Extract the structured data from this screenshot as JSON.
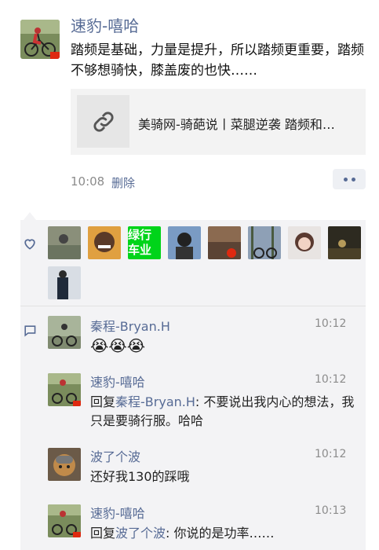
{
  "post": {
    "author": "速豹-嘻哈",
    "text": "踏频是基础，力量是提升，所以踏频更重要，踏频不够想骑快，膝盖废的也快……",
    "link_title": "美骑网-骑葩说丨菜腿逆袭 踏频和…",
    "time": "10:08",
    "delete_label": "删除",
    "more_icon": "ellipsis-icon"
  },
  "likes": {
    "icon": "heart-outline-icon",
    "green_badge_text": "绿行车业"
  },
  "comments_icon": "comment-icon",
  "comments": [
    {
      "name": "秦程-Bryan.H",
      "time": "10:12",
      "text": "😭😭😭",
      "reply_to": ""
    },
    {
      "name": "速豹-嘻哈",
      "time": "10:12",
      "reply_prefix": "回复",
      "reply_to": "秦程-Bryan.H",
      "text": ": 不要说出我内心的想法，我只是要骑行服。哈哈"
    },
    {
      "name": "波了个波",
      "time": "10:12",
      "text": "还好我130的踩哦",
      "reply_to": ""
    },
    {
      "name": "速豹-嘻哈",
      "time": "10:13",
      "reply_prefix": "回复",
      "reply_to": "波了个波",
      "text": ": 你说的是功率……"
    }
  ],
  "colors": {
    "link": "#576b95",
    "panel": "#f3f3f5"
  }
}
